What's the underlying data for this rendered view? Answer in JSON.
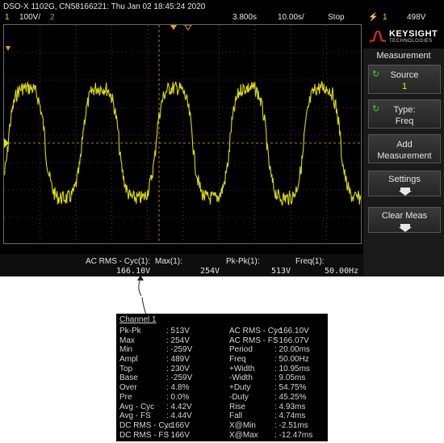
{
  "scope": {
    "header": "DSO-X 1102G, CN58166221: Thu Jan 02 18:45:24 2020",
    "channel_number": "1",
    "channel_scale": "100V/",
    "channel2_number": "2",
    "time_offset": "3.800s",
    "time_scale": "10.00s/",
    "run_state": "Stop",
    "trigger_symbol": "⚡",
    "trigger_channel": "1",
    "trigger_level": "498V",
    "brand": {
      "name": "KEYSIGHT",
      "sub": "TECHNOLOGIES"
    },
    "menu_title": "Measurement",
    "softkeys": [
      {
        "line1": "Source",
        "line2": "1"
      },
      {
        "line1": "Type:",
        "line2": "Freq"
      },
      {
        "line1": "Add",
        "line2": "Measurement"
      },
      {
        "line1": "Settings",
        "line2": ""
      },
      {
        "line1": "Clear Meas",
        "line2": ""
      }
    ],
    "measurements": [
      {
        "label": "AC RMS - Cyc(1):",
        "value": "166.10V"
      },
      {
        "label": "Max(1):",
        "value": "254V"
      },
      {
        "label": "Pk-Pk(1):",
        "value": "513V"
      },
      {
        "label": "Freq(1):",
        "value": "50.00Hz"
      }
    ],
    "colors": {
      "trace": "#e6e60c",
      "grid": "#7a7a7a",
      "marker": "#e8a020"
    }
  },
  "table": {
    "title": "Channel 1",
    "left": [
      {
        "k": "Pk-Pk",
        "v": ": 513V"
      },
      {
        "k": "Max",
        "v": ": 254V"
      },
      {
        "k": "Min",
        "v": ": -259V"
      },
      {
        "k": "Ampl",
        "v": ": 489V"
      },
      {
        "k": "Top",
        "v": ": 230V"
      },
      {
        "k": "Base",
        "v": ": -259V"
      },
      {
        "k": "Over",
        "v": ": 4.8%"
      },
      {
        "k": "Pre",
        "v": ": 0.0%"
      },
      {
        "k": "Avg - Cyc",
        "v": ": 4.42V"
      },
      {
        "k": "Avg - FS",
        "v": ": 4.44V"
      },
      {
        "k": "DC RMS - Cyc",
        "v": ": 166V"
      },
      {
        "k": "DC RMS - FS",
        "v": ": 166V"
      }
    ],
    "right": [
      {
        "k": "AC RMS - Cyc",
        "v": ": 166.10V"
      },
      {
        "k": "AC RMS - FS",
        "v": ": 166.07V"
      },
      {
        "k": "Period",
        "v": ": 20.00ms"
      },
      {
        "k": "Freq",
        "v": ": 50.00Hz"
      },
      {
        "k": "+Width",
        "v": ": 10.95ms"
      },
      {
        "k": "-Width",
        "v": ": 9.05ms"
      },
      {
        "k": "+Duty",
        "v": ": 54.75%"
      },
      {
        "k": "-Duty",
        "v": ": 45.25%"
      },
      {
        "k": "Rise",
        "v": ": 4.93ms"
      },
      {
        "k": "Fall",
        "v": ": 4.74ms"
      },
      {
        "k": "X@Min",
        "v": ": -2.51ms"
      },
      {
        "k": "X@Max",
        "v": ": -12.47ms"
      }
    ]
  }
}
